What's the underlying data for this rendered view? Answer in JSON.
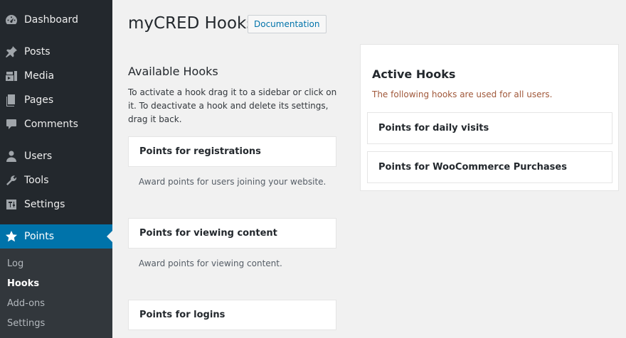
{
  "sidebar": {
    "items": [
      {
        "label": "Dashboard",
        "icon": "dashboard-icon"
      },
      {
        "label": "Posts",
        "icon": "pin-icon"
      },
      {
        "label": "Media",
        "icon": "media-icon"
      },
      {
        "label": "Pages",
        "icon": "pages-icon"
      },
      {
        "label": "Comments",
        "icon": "comment-icon"
      },
      {
        "label": "Users",
        "icon": "user-icon"
      },
      {
        "label": "Tools",
        "icon": "wrench-icon"
      },
      {
        "label": "Settings",
        "icon": "settings-icon"
      },
      {
        "label": "Points",
        "icon": "star-icon",
        "active": true
      }
    ],
    "submenu": [
      {
        "label": "Log"
      },
      {
        "label": "Hooks",
        "current": true
      },
      {
        "label": "Add-ons"
      },
      {
        "label": "Settings"
      }
    ],
    "colors": {
      "background": "#23282d",
      "active": "#0073aa",
      "submenu": "#32373c"
    }
  },
  "header": {
    "title": "myCRED Hooks",
    "doc_button": "Documentation"
  },
  "available": {
    "title": "Available Hooks",
    "description": "To activate a hook drag it to a sidebar or click on it. To deactivate a hook and delete its settings, drag it back.",
    "hooks": [
      {
        "title": "Points for registrations",
        "description": "Award points for users joining your website."
      },
      {
        "title": "Points for viewing content",
        "description": "Award points for viewing content."
      },
      {
        "title": "Points for logins",
        "description": ""
      }
    ]
  },
  "active": {
    "title": "Active Hooks",
    "description": "The following hooks are used for all users.",
    "hooks": [
      {
        "title": "Points for daily visits"
      },
      {
        "title": "Points for WooCommerce Purchases"
      }
    ]
  }
}
